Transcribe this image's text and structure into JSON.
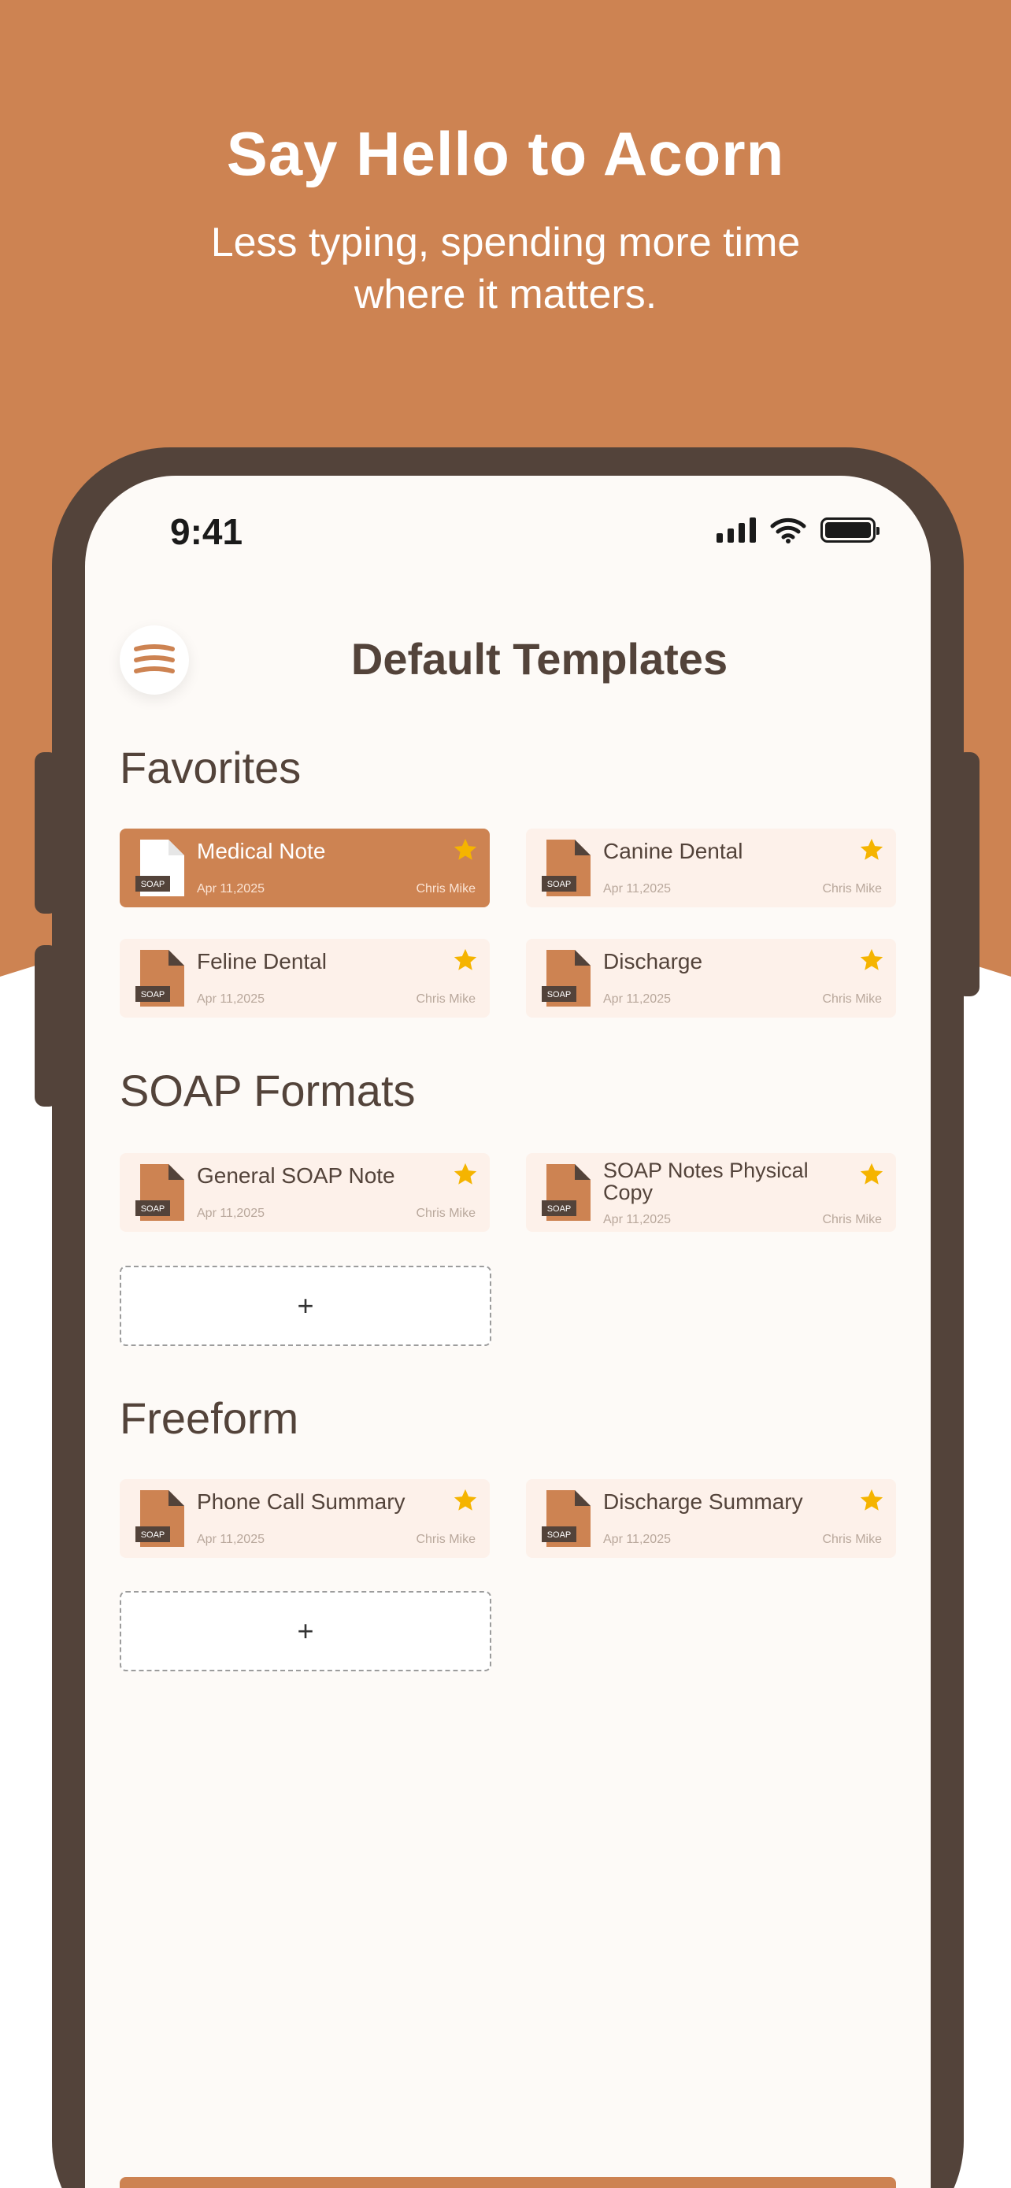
{
  "hero": {
    "title": "Say Hello to Acorn",
    "subtitle": "Less typing, spending more time where it matters."
  },
  "status": {
    "time": "9:41"
  },
  "header": {
    "title": "Default Templates"
  },
  "sections": {
    "favorites": {
      "title": "Favorites",
      "cards": [
        {
          "name": "Medical Note",
          "date": "Apr 11,2025",
          "author": "Chris Mike",
          "badge": "SOAP",
          "active": true
        },
        {
          "name": "Canine Dental",
          "date": "Apr 11,2025",
          "author": "Chris Mike",
          "badge": "SOAP"
        },
        {
          "name": "Feline Dental",
          "date": "Apr 11,2025",
          "author": "Chris Mike",
          "badge": "SOAP"
        },
        {
          "name": "Discharge",
          "date": "Apr 11,2025",
          "author": "Chris Mike",
          "badge": "SOAP"
        }
      ]
    },
    "soap": {
      "title": "SOAP Formats",
      "cards": [
        {
          "name": "General SOAP Note",
          "date": "Apr 11,2025",
          "author": "Chris Mike",
          "badge": "SOAP"
        },
        {
          "name": "SOAP Notes Physical Copy",
          "date": "Apr 11,2025",
          "author": "Chris Mike",
          "badge": "SOAP"
        }
      ],
      "add_label": "+"
    },
    "freeform": {
      "title": "Freeform",
      "cards": [
        {
          "name": "Phone Call Summary",
          "date": "Apr 11,2025",
          "author": "Chris Mike",
          "badge": "SOAP"
        },
        {
          "name": "Discharge Summary",
          "date": "Apr 11,2025",
          "author": "Chris Mike",
          "badge": "SOAP"
        }
      ],
      "add_label": "+"
    }
  },
  "colors": {
    "brand": "#cd8352",
    "dark": "#53433a",
    "star": "#f5b400",
    "card_bg": "#fdf1ea"
  },
  "icons": {
    "menu": "menu-icon",
    "file": "soap-file-icon",
    "star": "star-icon",
    "signal": "signal-icon",
    "wifi": "wifi-icon",
    "battery": "battery-icon"
  }
}
